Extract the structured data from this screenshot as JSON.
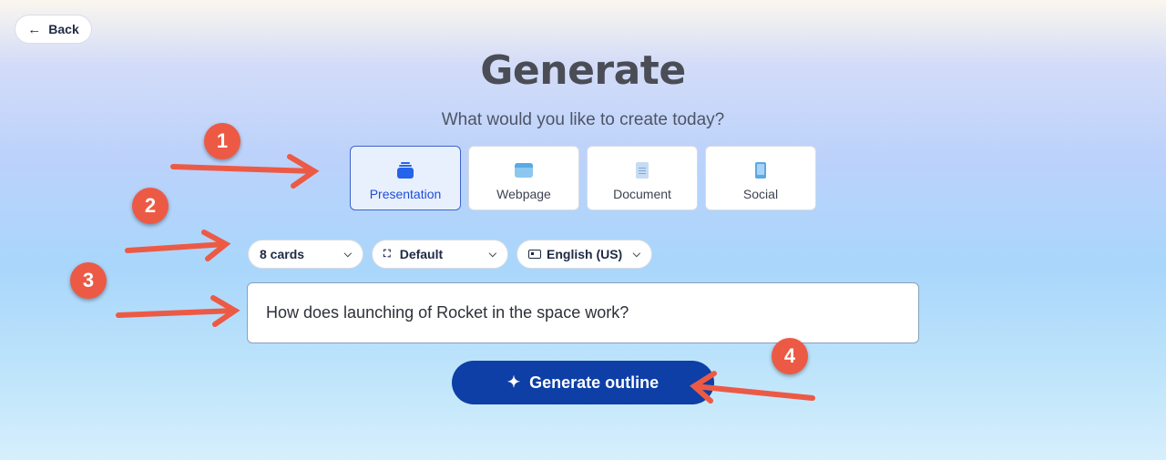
{
  "nav": {
    "back_label": "Back"
  },
  "header": {
    "title": "Generate",
    "subtitle": "What would you like to create today?"
  },
  "content_types": [
    {
      "label": "Presentation",
      "icon": "presentation-icon",
      "selected": true
    },
    {
      "label": "Webpage",
      "icon": "webpage-icon",
      "selected": false
    },
    {
      "label": "Document",
      "icon": "document-icon",
      "selected": false
    },
    {
      "label": "Social",
      "icon": "social-icon",
      "selected": false
    }
  ],
  "options": {
    "cards": "8 cards",
    "format": "Default",
    "language": "English (US)"
  },
  "prompt": {
    "value": "How does launching of Rocket in the space work?"
  },
  "actions": {
    "generate_label": "Generate outline"
  },
  "annotations": [
    "1",
    "2",
    "3",
    "4"
  ],
  "colors": {
    "accent": "#0d3fa6",
    "selected_border": "#3d64c9",
    "annotation": "#ec5a45"
  }
}
